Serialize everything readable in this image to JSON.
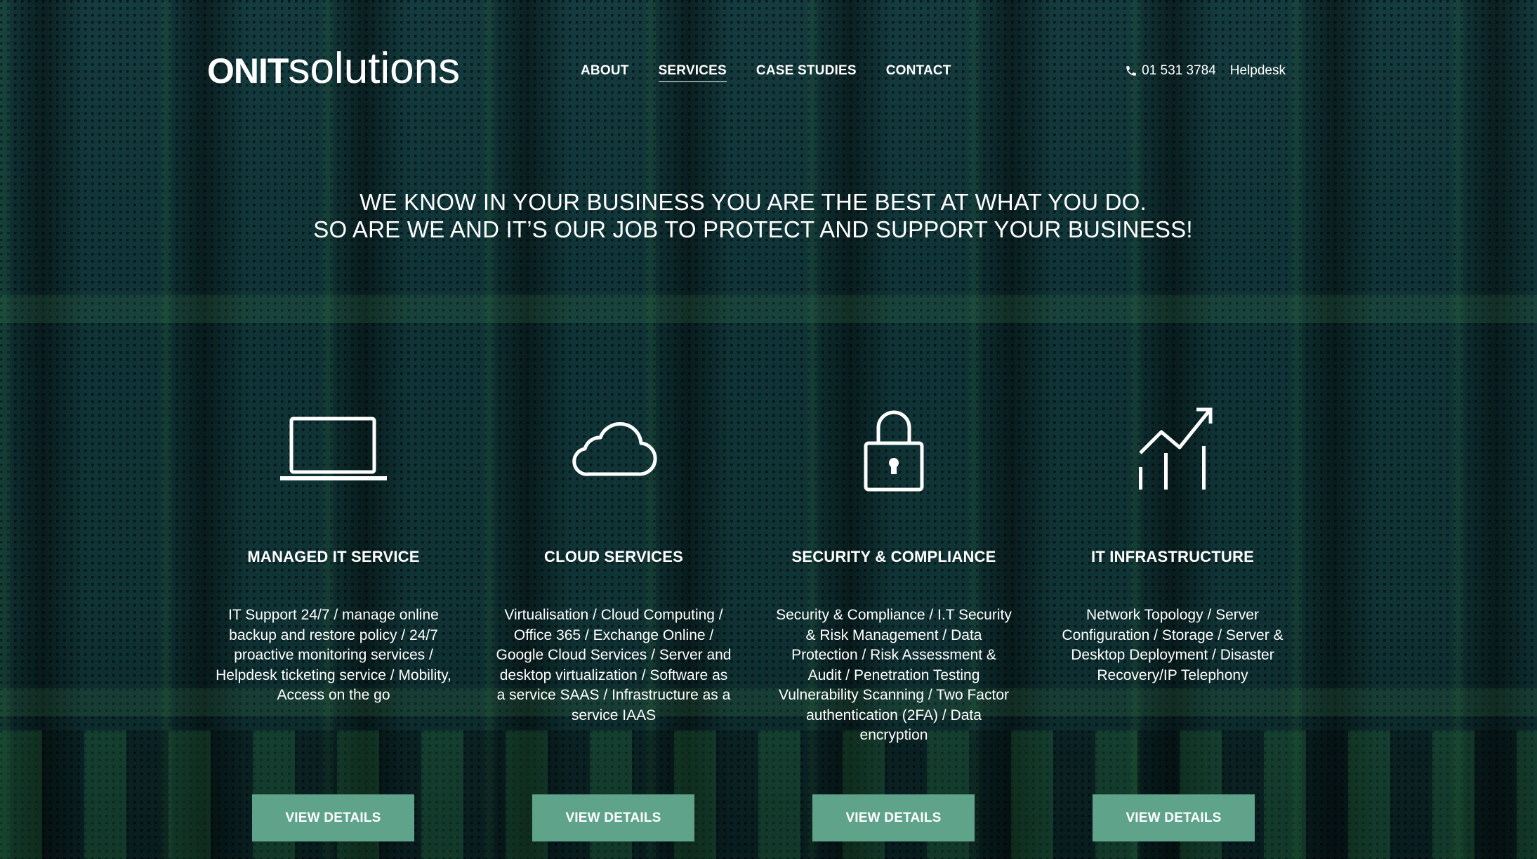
{
  "brand": {
    "logo_bold": "onit",
    "logo_light": "solutions"
  },
  "nav": {
    "items": [
      {
        "label": "ABOUT"
      },
      {
        "label": "SERVICES",
        "active": true
      },
      {
        "label": "CASE STUDIES"
      },
      {
        "label": "CONTACT"
      }
    ]
  },
  "contact": {
    "phone": "01 531 3784",
    "helpdesk": "Helpdesk",
    "phone_icon": "phone-icon"
  },
  "hero": {
    "line1": "WE KNOW IN YOUR BUSINESS YOU ARE THE BEST AT WHAT YOU DO.",
    "line2": "SO ARE WE AND IT’S OUR JOB TO PROTECT AND SUPPORT YOUR BUSINESS!"
  },
  "services": [
    {
      "icon": "laptop-icon",
      "title": "MANAGED IT SERVICE",
      "description": "IT Support 24/7 / manage online backup and restore policy / 24/7 proactive monitoring services / Helpdesk ticketing service / Mobility, Access on the go",
      "button": "VIEW DETAILS"
    },
    {
      "icon": "cloud-icon",
      "title": "CLOUD SERVICES",
      "description": "Virtualisation / Cloud Computing / Office 365 / Exchange Online / Google Cloud Services / Server and desktop virtualization / Software as a service SAAS / Infrastructure as a service IAAS",
      "button": "VIEW DETAILS"
    },
    {
      "icon": "lock-icon",
      "title": "SECURITY & COMPLIANCE",
      "description": "Security & Compliance / I.T Security & Risk Management / Data Protection / Risk Assessment & Audit / Penetration Testing Vulnerability Scanning / Two Factor authentication (2FA) / Data encryption",
      "button": "VIEW DETAILS"
    },
    {
      "icon": "growth-chart-icon",
      "title": "IT INFRASTRUCTURE",
      "description": "Network Topology / Server Configuration / Storage / Server & Desktop Deployment / Disaster Recovery/IP Telephony",
      "button": "VIEW DETAILS"
    }
  ],
  "colors": {
    "button_bg": "#5fa48a",
    "text": "#ffffff",
    "background": "#0f3336"
  }
}
